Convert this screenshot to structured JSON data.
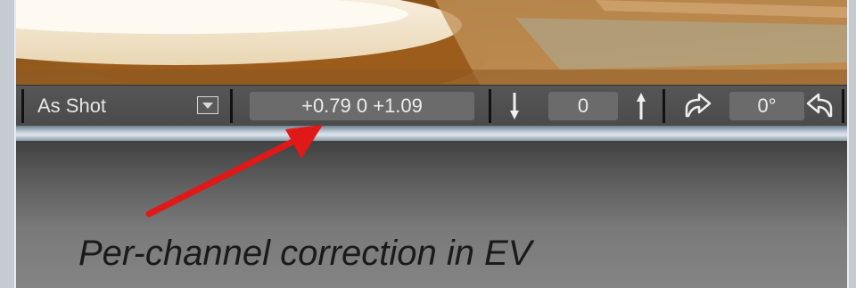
{
  "toolbar": {
    "white_balance_value": "As Shot",
    "channel_correction": "+0.79 0 +1.09",
    "exposure_value": "0",
    "rotation_value": "0°"
  },
  "icons": {
    "dropdown": "chevron-down-icon",
    "exposure_down": "arrow-down-icon",
    "exposure_up": "arrow-up-icon",
    "rotate_cw": "rotate-right-icon",
    "rotate_ccw": "rotate-left-icon"
  },
  "annotation": {
    "caption": "Per-channel correction in EV",
    "arrow_color": "#e01818"
  }
}
